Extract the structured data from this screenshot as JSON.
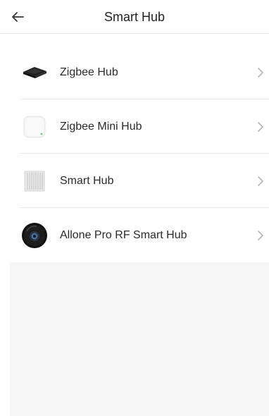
{
  "header": {
    "title": "Smart Hub",
    "back_icon": "arrow-left-icon"
  },
  "devices": [
    {
      "label": "Zigbee Hub",
      "icon": "zigbee-hub-icon"
    },
    {
      "label": "Zigbee Mini Hub",
      "icon": "zigbee-mini-hub-icon"
    },
    {
      "label": "Smart Hub",
      "icon": "smart-hub-icon"
    },
    {
      "label": "Allone Pro RF Smart Hub",
      "icon": "allone-pro-hub-icon"
    }
  ],
  "colors": {
    "background": "#ffffff",
    "panel": "#f5f5f5",
    "divider": "#e8e8e8",
    "text": "#2a2a2a",
    "chevron": "#b5b5b5"
  }
}
